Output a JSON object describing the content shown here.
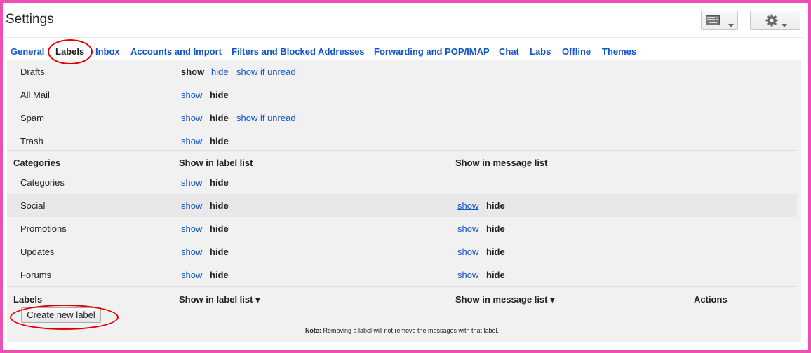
{
  "header": {
    "title": "Settings"
  },
  "icons": {
    "keyboard": "keyboard-icon",
    "settings": "gear-icon",
    "dropdown": "caret-down-icon"
  },
  "colors": {
    "link": "#1155cc",
    "frame": "#ee4fb2",
    "highlight": "#e00000"
  },
  "tabs": [
    {
      "label": "General"
    },
    {
      "label": "Labels",
      "active": true
    },
    {
      "label": "Inbox"
    },
    {
      "label": "Accounts and Import"
    },
    {
      "label": "Filters and Blocked Addresses"
    },
    {
      "label": "Forwarding and POP/IMAP"
    },
    {
      "label": "Chat"
    },
    {
      "label": "Labs"
    },
    {
      "label": "Offline"
    },
    {
      "label": "Themes"
    }
  ],
  "system_labels": [
    {
      "name": "Drafts",
      "opt1": "show",
      "opt2": "hide",
      "opt3": "show if unread"
    },
    {
      "name": "All Mail",
      "opt1": "show",
      "opt2": "hide"
    },
    {
      "name": "Spam",
      "opt1": "show",
      "opt2": "hide",
      "opt3": "show if unread"
    },
    {
      "name": "Trash",
      "opt1": "show",
      "opt2": "hide"
    }
  ],
  "categories_header": {
    "title": "Categories",
    "col_label_list": "Show in label list",
    "col_message_list": "Show in message list"
  },
  "categories": [
    {
      "name": "Categories",
      "label_show": "show",
      "label_hide": "hide"
    },
    {
      "name": "Social",
      "label_show": "show",
      "label_hide": "hide",
      "msg_show": "show",
      "msg_hide": "hide"
    },
    {
      "name": "Promotions",
      "label_show": "show",
      "label_hide": "hide",
      "msg_show": "show",
      "msg_hide": "hide"
    },
    {
      "name": "Updates",
      "label_show": "show",
      "label_hide": "hide",
      "msg_show": "show",
      "msg_hide": "hide"
    },
    {
      "name": "Forums",
      "label_show": "show",
      "label_hide": "hide",
      "msg_show": "show",
      "msg_hide": "hide"
    }
  ],
  "labels_header": {
    "title": "Labels",
    "col_label_list": "Show in label list ▾",
    "col_message_list": "Show in message list ▾",
    "col_actions": "Actions"
  },
  "create_button": "Create new label",
  "note": {
    "prefix": "Note:",
    "text": " Removing a label will not remove the messages with that label."
  }
}
